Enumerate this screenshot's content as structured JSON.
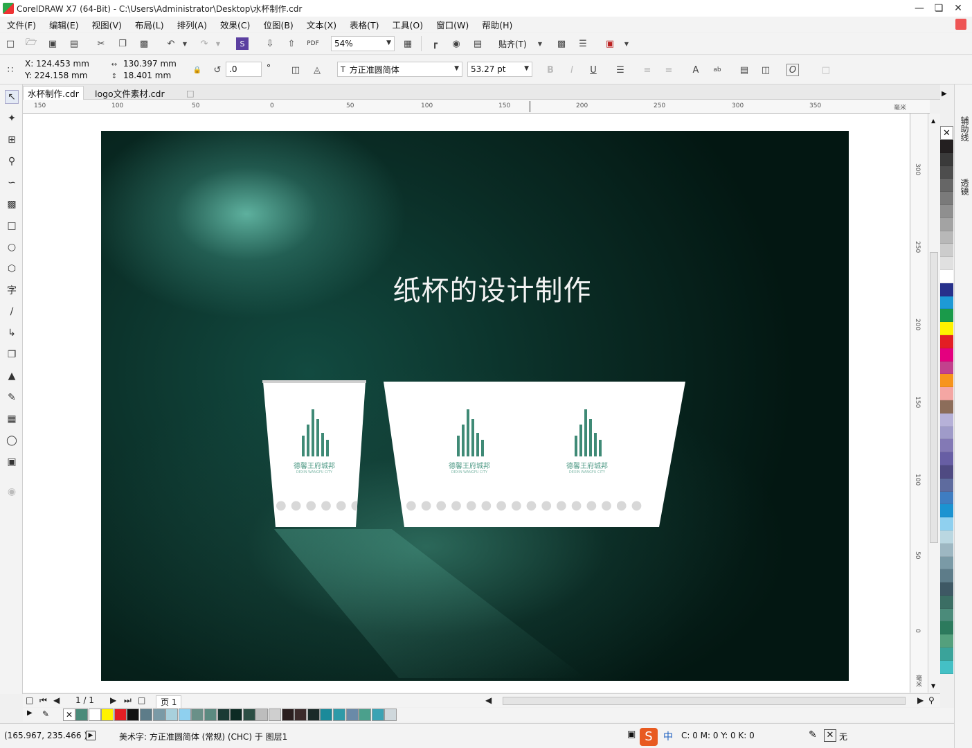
{
  "window": {
    "title": "CorelDRAW X7 (64-Bit) - C:\\Users\\Administrator\\Desktop\\水杯制作.cdr"
  },
  "menu": [
    "文件(F)",
    "编辑(E)",
    "视图(V)",
    "布局(L)",
    "排列(A)",
    "效果(C)",
    "位图(B)",
    "文本(X)",
    "表格(T)",
    "工具(O)",
    "窗口(W)",
    "帮助(H)"
  ],
  "toolbar": {
    "zoom": "54%",
    "snap": "贴齐(T)"
  },
  "props": {
    "x": "X: 124.453 mm",
    "y": "Y: 224.158 mm",
    "w": "130.397 mm",
    "h": "18.401 mm",
    "rotation": ".0",
    "degree": "°",
    "font": "方正准圆简体",
    "font_size": "53.27 pt"
  },
  "tabs": [
    "水杯制作.cdr",
    "logo文件素材.cdr"
  ],
  "ruler_h": [
    "150",
    "100",
    "50",
    "0",
    "50",
    "100",
    "150",
    "200",
    "250",
    "300",
    "350",
    "毫米"
  ],
  "ruler_v": [
    "300",
    "250",
    "200",
    "150",
    "100",
    "50",
    "0",
    "毫米"
  ],
  "canvas": {
    "title": "纸杯的设计制作",
    "logo_text": "德馨王府城邦",
    "logo_sub": "DEXIN WANGFU CITY"
  },
  "nav": {
    "page": "1 / 1",
    "page_tab": "页 1"
  },
  "dock": {
    "guides": "辅助线",
    "lens": "透镜"
  },
  "palette_v": [
    "#231f20",
    "#3a3a3a",
    "#4d4d4d",
    "#666666",
    "#7a7a7a",
    "#8f8f8f",
    "#a3a3a3",
    "#b8b8b8",
    "#cccccc",
    "#e0e0e0",
    "#ffffff",
    "#27318b",
    "#1d9ad6",
    "#1a9a4a",
    "#fff200",
    "#e31e24",
    "#e4007f",
    "#c2418d",
    "#f7941d",
    "#f4a6a3",
    "#8c6d5a",
    "#b6b1d8",
    "#9f9bc9",
    "#8379b5",
    "#675ea4",
    "#4f4a82",
    "#5e6b9e",
    "#3f7dc1",
    "#1b93d1",
    "#8fd0ef",
    "#bad7e1",
    "#9db7c2",
    "#7a9aa6",
    "#5d7c89",
    "#3e5864",
    "#3b6e64",
    "#4b8b7a",
    "#2c7a5d",
    "#54a07d",
    "#3aa39a",
    "#44c0c5"
  ],
  "palette_h": [
    "#4b8b7a",
    "#ffffff",
    "#fff200",
    "#e31e24",
    "#111111",
    "#5d7c89",
    "#7a9aa6",
    "#a8d0dc",
    "#8fd0ef",
    "#6a9088",
    "#5b8a80",
    "#1b3a35",
    "#0d2b24",
    "#2c4e44",
    "#bdbdbd",
    "#cfcfcf",
    "#2a1e1e",
    "#3b2a2a",
    "#1a2a28",
    "#1b8a9a",
    "#2e9aa8",
    "#6a8aa8",
    "#4ba08c",
    "#3aa3b4",
    "#cfd8dc"
  ],
  "status": {
    "coords": "(165.967, 235.466 )",
    "info": "美术字: 方正准圆简体 (常规) (CHC) 于 图层1",
    "ime": "中",
    "color": "C: 0 M: 0 Y: 0 K: 0",
    "fill": "无"
  }
}
